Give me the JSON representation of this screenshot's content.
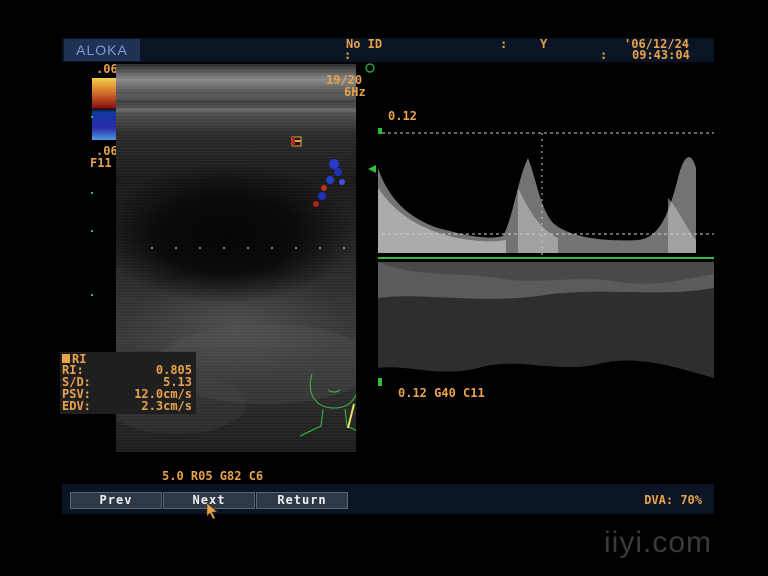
{
  "header": {
    "logo": "ALOKA",
    "patient_id_label": "No ID",
    "separator": ":",
    "field_y": "Y",
    "date": "'06/12/24",
    "time": "09:43:04",
    "time_separator": ":"
  },
  "bmode": {
    "frame_info": "19/20",
    "freq": "6Hz",
    "color_scale_top": ".06",
    "color_scale_bottom": ".06",
    "filter": "F11",
    "params": "5.0 R05 G82 C6"
  },
  "doppler": {
    "scale_top": "0.12",
    "params": "0.12 G40 C11"
  },
  "measurements": {
    "header": "RI",
    "rows": [
      {
        "label": "RI:",
        "value": "0.805"
      },
      {
        "label": "S/D:",
        "value": "5.13"
      },
      {
        "label": "PSV:",
        "value": "12.0cm/s"
      },
      {
        "label": "EDV:",
        "value": "2.3cm/s"
      }
    ]
  },
  "footer": {
    "prev": "Prev",
    "next": "Next",
    "return": "Return",
    "dva": "DVA: 70%"
  },
  "watermark": "iiyi.com",
  "colors": {
    "text_orange": "#e8a24a",
    "marker_green": "#2fbf3a",
    "bar_bg": "#0b1424"
  },
  "icons": {
    "body_marker": "neck-body-marker-icon",
    "cursor": "mouse-pointer-icon"
  }
}
